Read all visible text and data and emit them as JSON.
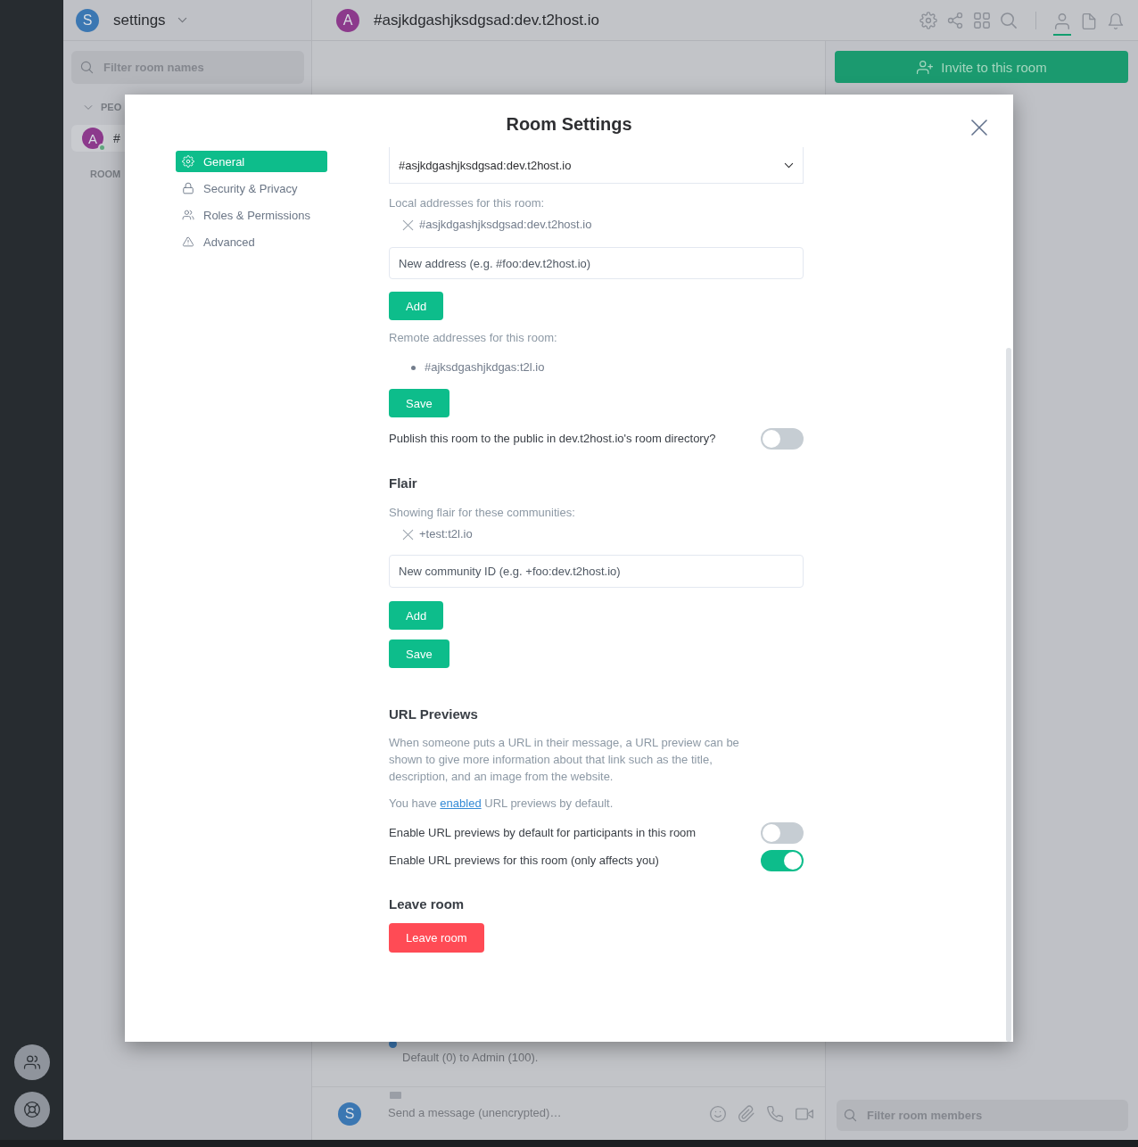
{
  "spaces_bar": {
    "buttons": [
      {
        "kind": "people"
      },
      {
        "kind": "help"
      }
    ]
  },
  "room_list": {
    "header": {
      "avatar": "S",
      "title": "settings"
    },
    "search": {
      "placeholder": "Filter room names"
    },
    "people_section": {
      "label": "PEO",
      "expanded": true,
      "rooms": [
        {
          "avatar": "A",
          "name": "#",
          "selected": true,
          "online": true
        }
      ]
    },
    "rooms_section": {
      "label": "ROOM"
    }
  },
  "room_header": {
    "avatar": "A",
    "name": "#asjkdgashjksdgsad:dev.t2host.io",
    "tools": [
      {
        "kind": "settings"
      },
      {
        "kind": "share"
      },
      {
        "kind": "apps"
      },
      {
        "kind": "search"
      }
    ],
    "panel_tabs": [
      {
        "kind": "members",
        "selected": true
      },
      {
        "kind": "files",
        "selected": false
      },
      {
        "kind": "notifications",
        "selected": false
      }
    ]
  },
  "timeline": {
    "event": "Default (0) to Admin (100)."
  },
  "composer": {
    "avatar": "S",
    "placeholder": "Send a message (unencrypted)…",
    "tools": [
      {
        "kind": "emoji"
      },
      {
        "kind": "attachment"
      },
      {
        "kind": "voice_call"
      },
      {
        "kind": "video_call"
      }
    ]
  },
  "right_panel": {
    "invite_button": "Invite to this room",
    "search": {
      "placeholder": "Filter room members"
    }
  },
  "dialog": {
    "title": "Room Settings",
    "tabs": [
      {
        "kind": "general",
        "label": "General",
        "selected": true
      },
      {
        "kind": "security",
        "label": "Security & Privacy",
        "selected": false
      },
      {
        "kind": "roles",
        "label": "Roles & Permissions",
        "selected": false
      },
      {
        "kind": "advanced",
        "label": "Advanced",
        "selected": false
      }
    ],
    "general": {
      "main_address": {
        "value": "#asjkdgashjksdgsad:dev.t2host.io"
      },
      "local_addresses": {
        "label": "Local addresses for this room:",
        "items": [
          "#asjkdgashjksdgsad:dev.t2host.io"
        ],
        "new_address": {
          "placeholder": "New address (e.g. #foo:dev.t2host.io)"
        },
        "add_button": "Add"
      },
      "remote_addresses": {
        "label": "Remote addresses for this room:",
        "items": [
          "#ajksdgashjkdgas:t2l.io"
        ],
        "save_button": "Save"
      },
      "publish": {
        "label": "Publish this room to the public in dev.t2host.io's room directory?",
        "on": false
      },
      "flair": {
        "heading": "Flair",
        "label": "Showing flair for these communities:",
        "items": [
          "+test:t2l.io"
        ],
        "new_community": {
          "placeholder": "New community ID (e.g. +foo:dev.t2host.io)"
        },
        "add_button": "Add",
        "save_button": "Save"
      },
      "url_previews": {
        "heading": "URL Previews",
        "description": "When someone puts a URL in their message, a URL preview can be shown to give more information about that link such as the title, description, and an image from the website.",
        "default_note": {
          "before": "You have ",
          "link": "enabled",
          "after": " URL previews by default."
        },
        "toggles": [
          {
            "label": "Enable URL previews by default for participants in this room",
            "on": false
          },
          {
            "label": "Enable URL previews for this room (only affects you)",
            "on": true
          }
        ]
      },
      "leave": {
        "heading": "Leave room",
        "button": "Leave room"
      }
    }
  }
}
